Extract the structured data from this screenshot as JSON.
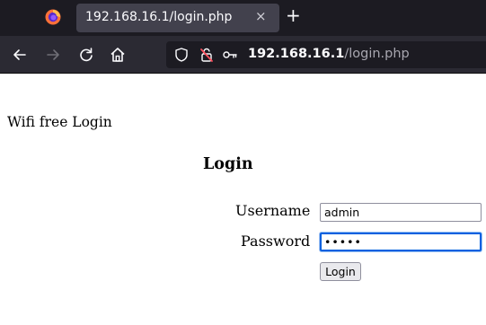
{
  "browser": {
    "tab": {
      "title": "192.168.16.1/login.php",
      "close_glyph": "×"
    },
    "new_tab_glyph": "+",
    "nav": {
      "back_icon": "back-arrow-icon",
      "forward_icon": "forward-arrow-icon",
      "reload_icon": "reload-icon",
      "home_icon": "home-icon"
    },
    "urlbar": {
      "host": "192.168.16.1",
      "path": "/login.php"
    },
    "colors": {
      "tab_strip": "#1c1b22",
      "active_tab": "#42414d",
      "nav_bar": "#2b2a33",
      "url_field": "#1c1b22"
    }
  },
  "page": {
    "site_title": "Wifi free Login",
    "heading": "Login",
    "form": {
      "username_label": "Username",
      "username_value": "admin",
      "password_label": "Password",
      "password_masked": "•••••",
      "submit_label": "Login"
    },
    "colors": {
      "focus_ring": "#0060df"
    }
  }
}
